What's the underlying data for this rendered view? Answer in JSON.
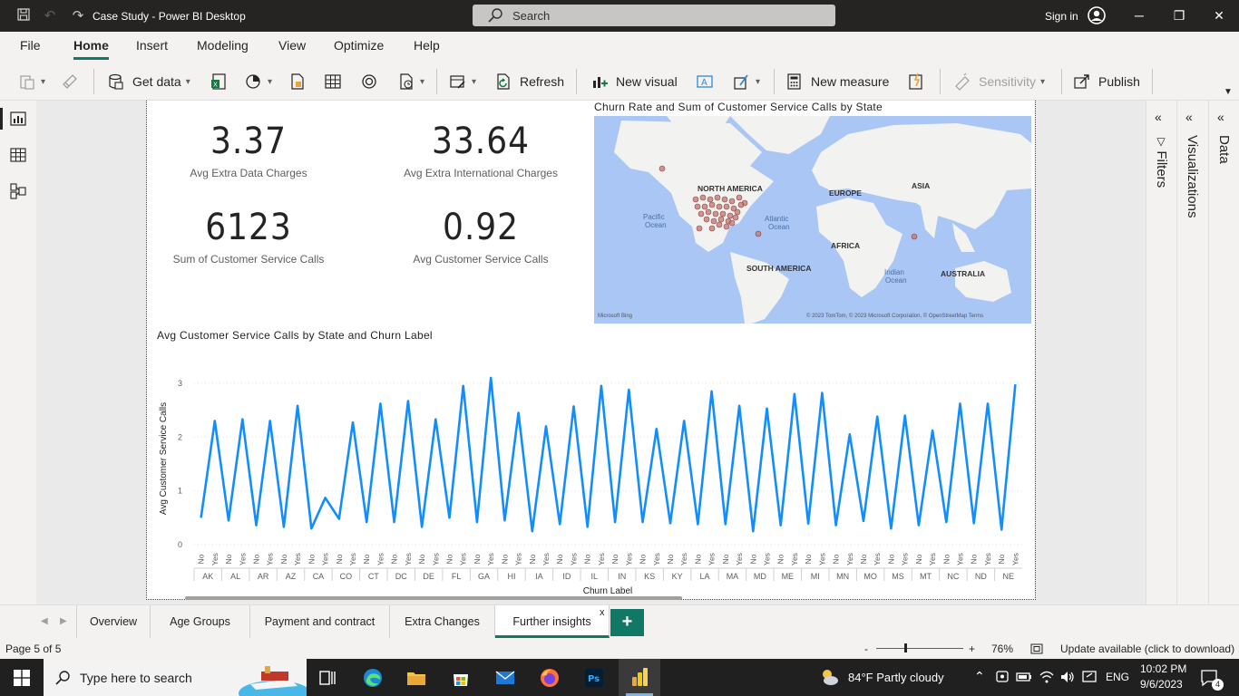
{
  "titlebar": {
    "title": "Case Study - Power BI Desktop",
    "search_placeholder": "Search",
    "signin": "Sign in"
  },
  "menu": {
    "tabs": [
      "File",
      "Home",
      "Insert",
      "Modeling",
      "View",
      "Optimize",
      "Help"
    ],
    "active": "Home"
  },
  "ribbon": {
    "get_data": "Get data",
    "refresh": "Refresh",
    "new_visual": "New visual",
    "new_measure": "New measure",
    "sensitivity": "Sensitivity",
    "publish": "Publish"
  },
  "cards": [
    {
      "value": "3.37",
      "label": "Avg Extra Data Charges"
    },
    {
      "value": "33.64",
      "label": "Avg Extra International Charges"
    },
    {
      "value": "6123",
      "label": "Sum of Customer Service Calls"
    },
    {
      "value": "0.92",
      "label": "Avg Customer Service Calls"
    }
  ],
  "map": {
    "title": "Churn Rate and Sum of Customer Service Calls by State",
    "labels": {
      "north_america": "NORTH AMERICA",
      "europe": "EUROPE",
      "asia": "ASIA",
      "africa": "AFRICA",
      "south_america": "SOUTH AMERICA",
      "australia": "AUSTRALIA",
      "pacific": "Pacific",
      "pacific2": "Ocean",
      "atlantic": "Atlantic",
      "atlantic2": "Ocean",
      "indian": "Indian",
      "indian2": "Ocean"
    },
    "bing": "Microsoft Bing",
    "copyright": "© 2023 TomTom, © 2023 Microsoft Corporation, © OpenStreetMap  Terms",
    "colors": {
      "water": "#a9c6f5",
      "land": "#f2f2f0",
      "bubble": "#c6736f"
    }
  },
  "chart_data": {
    "type": "line",
    "title": "Avg Customer Service Calls by State and Churn Label",
    "xlabel": "Churn Label",
    "ylabel": "Avg Customer Service Calls",
    "ylim": [
      0,
      3.2
    ],
    "yticks": [
      0,
      1,
      2,
      3
    ],
    "grid": true,
    "color": "#118dff",
    "states": [
      "AK",
      "AL",
      "AR",
      "AZ",
      "CA",
      "CO",
      "CT",
      "DC",
      "DE",
      "FL",
      "GA",
      "HI",
      "IA",
      "ID",
      "IL",
      "IN",
      "KS",
      "KY",
      "LA",
      "MA",
      "MD",
      "ME",
      "MI",
      "MN",
      "MO",
      "MS",
      "MT",
      "NC",
      "ND",
      "NE"
    ],
    "sub_categories": [
      "No",
      "Yes"
    ],
    "values": [
      0.5,
      2.3,
      0.45,
      2.33,
      0.36,
      2.3,
      0.33,
      2.58,
      0.3,
      0.87,
      0.48,
      2.27,
      0.42,
      2.62,
      0.42,
      2.67,
      0.33,
      2.33,
      0.5,
      2.95,
      0.42,
      3.1,
      0.45,
      2.45,
      0.25,
      2.2,
      0.38,
      2.57,
      0.33,
      2.95,
      0.42,
      2.88,
      0.42,
      2.15,
      0.4,
      2.3,
      0.38,
      2.85,
      0.38,
      2.58,
      0.25,
      2.53,
      0.36,
      2.8,
      0.39,
      2.82,
      0.36,
      2.05,
      0.44,
      2.38,
      0.3,
      2.4,
      0.36,
      2.12,
      0.42,
      2.62,
      0.4,
      2.62,
      0.28,
      2.98
    ]
  },
  "right_panes": [
    "Filters",
    "Visualizations",
    "Data"
  ],
  "page_tabs": {
    "tabs": [
      "Overview",
      "Age Groups",
      "Payment and contract",
      "Extra Changes",
      "Further insights"
    ],
    "active": "Further insights",
    "close": "x",
    "add": "+"
  },
  "status": {
    "page": "Page 5 of 5",
    "zoom_minus": "-",
    "zoom_plus": "+",
    "zoom": "76%",
    "update": "Update available (click to download)"
  },
  "taskbar": {
    "search_placeholder": "Type here to search",
    "weather": "84°F  Partly cloudy",
    "lang": "ENG",
    "time": "10:02 PM",
    "date": "9/6/2023",
    "notif_count": "4"
  }
}
